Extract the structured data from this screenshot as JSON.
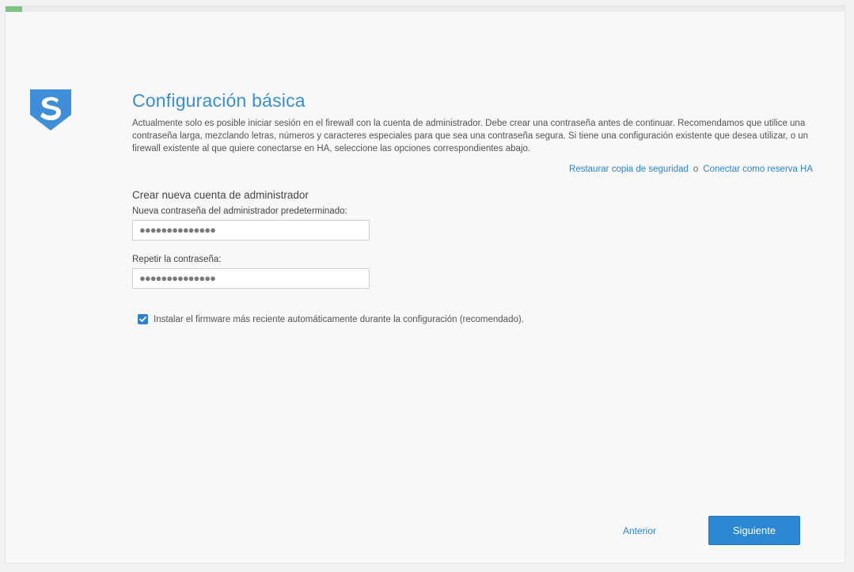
{
  "progress": {
    "fraction": 0.02
  },
  "header": {
    "title": "Configuración básica",
    "intro": "Actualmente solo es posible iniciar sesión en el firewall con la cuenta de administrador. Debe crear una contraseña antes de continuar. Recomendamos que utilice una contraseña larga, mezclando letras, números y caracteres especiales para que sea una contraseña segura. Si tiene una configuración existente que desea utilizar, o un firewall existente al que quiere conectarse en HA, seleccione las opciones correspondientes abajo."
  },
  "links": {
    "restore": "Restaurar copia de seguridad",
    "or": "o",
    "ha": "Conectar como reserva HA"
  },
  "form": {
    "section_title": "Crear nueva cuenta de administrador",
    "password_label": "Nueva contraseña del administrador predeterminado:",
    "password_value": "●●●●●●●●●●●●●●",
    "repeat_label": "Repetir la contraseña:",
    "repeat_value": "●●●●●●●●●●●●●●",
    "firmware_checkbox_label": "Instalar el firmware más reciente automáticamente durante la configuración (recomendado).",
    "firmware_checked": true
  },
  "footer": {
    "prev_label": "Anterior",
    "next_label": "Siguiente"
  },
  "colors": {
    "accent": "#3b8fd1",
    "progress": "#7dc383",
    "button": "#2b87d1"
  }
}
